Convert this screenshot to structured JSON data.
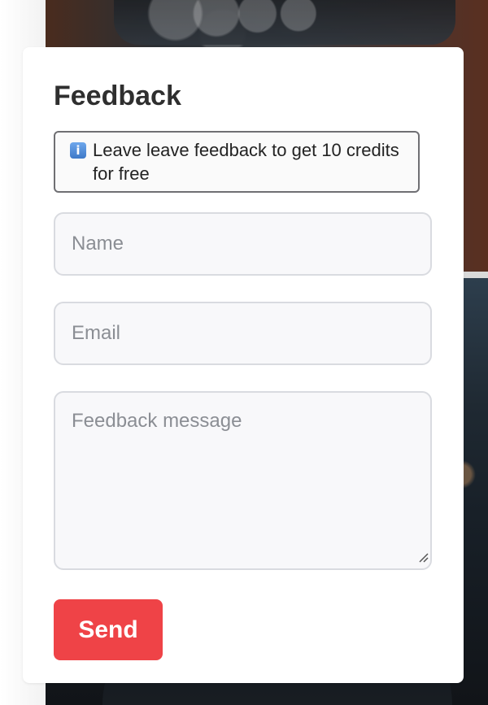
{
  "feedback_modal": {
    "title": "Feedback",
    "info_icon": "info-icon",
    "info_text": "Leave leave feedback to get 10 credits for free",
    "name_placeholder": "Name",
    "email_placeholder": "Email",
    "message_placeholder": "Feedback message",
    "send_label": "Send",
    "send_color": "#ef4347"
  }
}
